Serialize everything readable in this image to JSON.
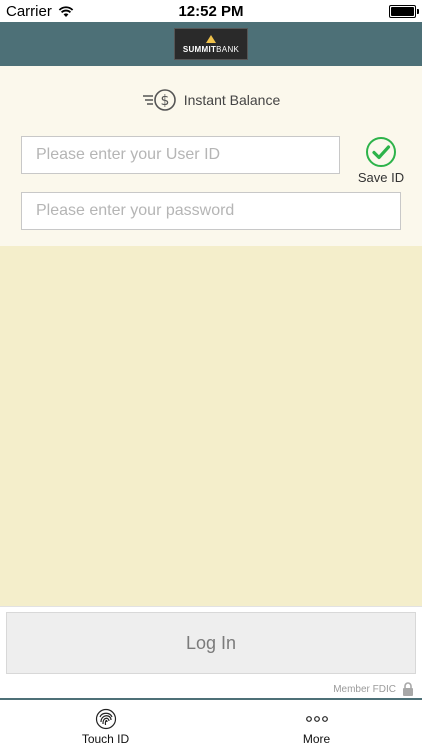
{
  "status_bar": {
    "carrier": "Carrier",
    "time": "12:52 PM"
  },
  "header": {
    "logo_text_bold": "SUMMIT",
    "logo_text_light": "BANK"
  },
  "login_form": {
    "instant_balance_label": "Instant Balance",
    "user_id_placeholder": "Please enter your User ID",
    "password_placeholder": "Please enter your password",
    "save_id_label": "Save ID",
    "save_id_checked": true,
    "login_button": "Log In",
    "member_fdic": "Member FDIC"
  },
  "tabs": [
    {
      "label": "Touch ID",
      "icon": "fingerprint-icon"
    },
    {
      "label": "More",
      "icon": "more-icon"
    }
  ],
  "colors": {
    "header": "#4d7077",
    "top_panel": "#fbf8ec",
    "mid_panel": "#f4eecb",
    "check": "#2db34a"
  }
}
